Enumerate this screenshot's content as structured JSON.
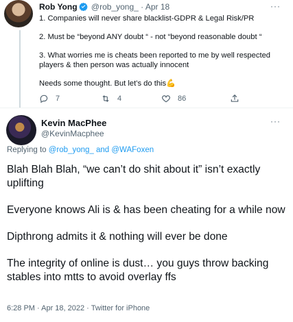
{
  "tweet1": {
    "name": "Rob Yong",
    "handle": "@rob_yong_",
    "separator": "·",
    "date": "Apr 18",
    "more": "···",
    "lines": [
      "1. Companies will never share blacklist-GDPR & Legal Risk/PR",
      "2. Must be “beyond ANY doubt “ - not “beyond reasonable doubt “",
      "3. What worries me is cheats been reported to me by well respected players & then person was actually innocent",
      "Needs some thought. But let’s do this💪"
    ],
    "actions": {
      "replies": "7",
      "retweets": "4",
      "likes": "86"
    }
  },
  "tweet2": {
    "name": "Kevin MacPhee",
    "handle": "@KevinMacphee",
    "more": "···",
    "replying_prefix": "Replying to",
    "replying_user1": "@rob_yong_",
    "replying_and": "and",
    "replying_user2": "@WAFoxen",
    "paragraphs": [
      "Blah Blah Blah, “we can’t do shit about it” isn’t exactly uplifting",
      "Everyone knows Ali is & has been cheating for a while now",
      "Dipthrong admits it & nothing will ever be done",
      "The integrity of online is dust… you guys throw backing stables into mtts to avoid overlay ffs"
    ],
    "footer": "6:28 PM · Apr 18, 2022 · Twitter for iPhone"
  },
  "colors": {
    "accent": "#1d9bf0",
    "secondary_text": "#536471",
    "primary_text": "#0f1419"
  }
}
